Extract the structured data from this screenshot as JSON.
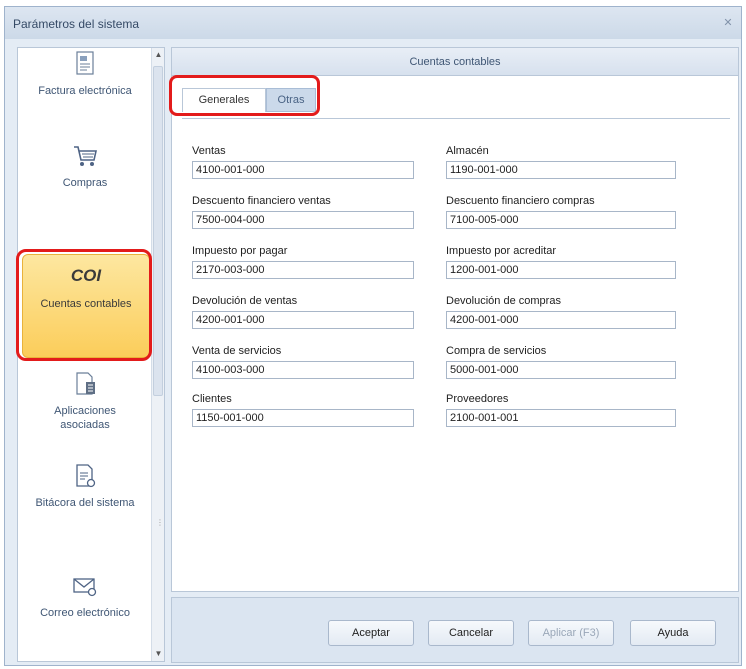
{
  "window": {
    "title": "Parámetros del sistema",
    "close_glyph": "✕"
  },
  "sidebar": {
    "items": [
      {
        "label": "Factura electrónica",
        "icon": "invoice-icon"
      },
      {
        "label": "Compras",
        "icon": "cart-icon"
      },
      {
        "label": "Cuentas contables",
        "icon": "coi-icon",
        "badge": "COI",
        "selected": true
      },
      {
        "label": "Aplicaciones asociadas",
        "icon": "apps-icon"
      },
      {
        "label": "Bitácora del sistema",
        "icon": "log-icon"
      },
      {
        "label": "Correo electrónico",
        "icon": "mail-icon"
      }
    ]
  },
  "main": {
    "header": "Cuentas contables",
    "tabs": [
      {
        "label": "Generales",
        "active": true
      },
      {
        "label": "Otras",
        "active": false
      }
    ],
    "fields_left": [
      {
        "label": "Ventas",
        "value": "4100-001-000"
      },
      {
        "label": "Descuento financiero ventas",
        "value": "7500-004-000"
      },
      {
        "label": "Impuesto por pagar",
        "value": "2170-003-000"
      },
      {
        "label": "Devolución de ventas",
        "value": "4200-001-000"
      },
      {
        "label": "Venta de servicios",
        "value": "4100-003-000"
      },
      {
        "label": "Clientes",
        "value": "1150-001-000"
      }
    ],
    "fields_right": [
      {
        "label": "Almacén",
        "value": "1190-001-000"
      },
      {
        "label": "Descuento financiero compras",
        "value": "7100-005-000"
      },
      {
        "label": "Impuesto por acreditar",
        "value": "1200-001-000"
      },
      {
        "label": "Devolución de compras",
        "value": "4200-001-000"
      },
      {
        "label": "Compra de servicios",
        "value": "5000-001-000"
      },
      {
        "label": "Proveedores",
        "value": "2100-001-001"
      }
    ]
  },
  "footer": {
    "accept": "Aceptar",
    "cancel": "Cancelar",
    "apply": "Aplicar (F3)",
    "help": "Ayuda"
  },
  "colors": {
    "accent_selected": "#fbcd5a",
    "highlight_outline": "#e31b1b",
    "panel_bg": "#e4ecf5"
  }
}
